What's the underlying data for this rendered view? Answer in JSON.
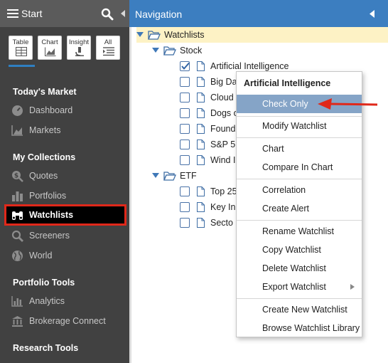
{
  "sidebar": {
    "title": "Start",
    "view_tabs": [
      {
        "label": "Table"
      },
      {
        "label": "Chart"
      },
      {
        "label": "Insight"
      },
      {
        "label": "All"
      }
    ],
    "sections": {
      "todays_market": "Today's Market",
      "my_collections": "My Collections",
      "portfolio_tools": "Portfolio Tools",
      "research_tools": "Research Tools"
    },
    "items": {
      "dashboard": "Dashboard",
      "markets": "Markets",
      "quotes": "Quotes",
      "portfolios": "Portfolios",
      "watchlists": "Watchlists",
      "screeners": "Screeners",
      "world": "World",
      "analytics": "Analytics",
      "brokerage_connect": "Brokerage Connect"
    }
  },
  "navigation": {
    "title": "Navigation",
    "root": "Watchlists",
    "stock_folder": "Stock",
    "stock_items": [
      "Artificial Intelligence",
      "Big Da",
      "Cloud",
      "Dogs o",
      "Found",
      "S&P 5",
      "Wind I"
    ],
    "etf_folder": "ETF",
    "etf_items": [
      "Top 25",
      "Key In",
      "Secto"
    ]
  },
  "context_menu": {
    "title": "Artificial Intelligence",
    "check_only": "Check Only",
    "modify_watchlist": "Modify Watchlist",
    "chart": "Chart",
    "compare_in_chart": "Compare In Chart",
    "correlation": "Correlation",
    "create_alert": "Create Alert",
    "rename_watchlist": "Rename Watchlist",
    "copy_watchlist": "Copy Watchlist",
    "delete_watchlist": "Delete Watchlist",
    "export_watchlist": "Export Watchlist",
    "create_new_watchlist": "Create New Watchlist",
    "browse_watchlist_library": "Browse Watchlist Library"
  },
  "colors": {
    "sidebar_bg": "#414141",
    "nav_header": "#3c7ec0",
    "highlight": "#85a4c7",
    "annotation": "#e0281a"
  }
}
